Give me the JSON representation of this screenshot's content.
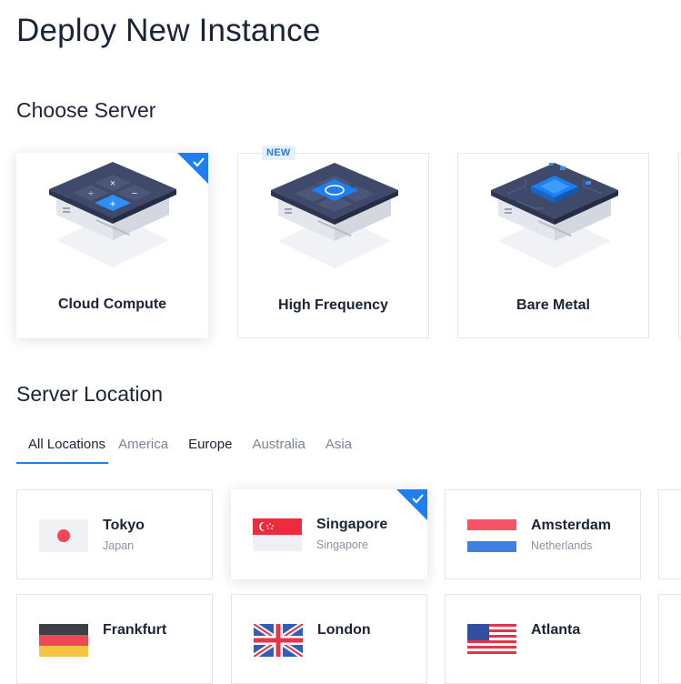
{
  "page": {
    "title": "Deploy New Instance"
  },
  "choose_server": {
    "title": "Choose Server",
    "cards": [
      {
        "label": "Cloud Compute",
        "selected": true
      },
      {
        "label": "High Frequency",
        "badge": "NEW",
        "selected": false
      },
      {
        "label": "Bare Metal",
        "selected": false
      }
    ]
  },
  "server_location": {
    "title": "Server Location",
    "tabs": [
      "All Locations",
      "America",
      "Europe",
      "Australia",
      "Asia"
    ],
    "active_tab": "All Locations",
    "locations": [
      {
        "city": "Tokyo",
        "country": "Japan",
        "flag": "flag-japan",
        "selected": false
      },
      {
        "city": "Singapore",
        "country": "Singapore",
        "flag": "flag-singapore",
        "selected": true
      },
      {
        "city": "Amsterdam",
        "country": "Netherlands",
        "flag": "flag-netherlands",
        "selected": false
      },
      {
        "city": "Frankfurt",
        "flag": "flag-germany",
        "selected": false
      },
      {
        "city": "London",
        "flag": "flag-uk",
        "selected": false
      },
      {
        "city": "Atlanta",
        "flag": "flag-usa",
        "selected": false
      }
    ]
  },
  "colors": {
    "accent": "#1f7ff0",
    "text": "#1b2437",
    "muted": "#8a92a2",
    "border": "#e3e6ec"
  }
}
